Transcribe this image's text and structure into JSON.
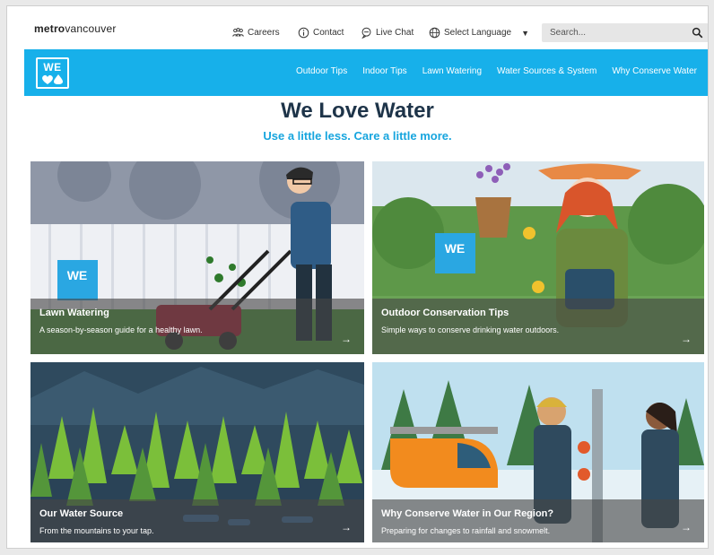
{
  "header": {
    "logo_bold": "metro",
    "logo_rest": "vancouver",
    "links": {
      "careers": "Careers",
      "contact": "Contact",
      "live_chat": "Live Chat",
      "language": "Select Language"
    },
    "search_placeholder": "Search..."
  },
  "nav": {
    "brand_text": "WE",
    "items": [
      "Outdoor Tips",
      "Indoor Tips",
      "Lawn Watering",
      "Water Sources & System",
      "Why Conserve Water"
    ]
  },
  "hero": {
    "title": "We Love Water",
    "subtitle": "Use a little less. Care a little more."
  },
  "cards": [
    {
      "title": "Lawn Watering",
      "desc": "A season-by-season guide for a healthy lawn.",
      "arrow": "→"
    },
    {
      "title": "Outdoor Conservation Tips",
      "desc": "Simple ways to conserve drinking water outdoors.",
      "arrow": "→"
    },
    {
      "title": "Our Water Source",
      "desc": "From the mountains to your tap.",
      "arrow": "→"
    },
    {
      "title": "Why Conserve Water in Our Region?",
      "desc": "Preparing for changes to rainfall and snowmelt.",
      "arrow": "→"
    }
  ],
  "colors": {
    "nav_blue": "#17b0ea",
    "title_navy": "#1e3449",
    "subtitle_blue": "#17a5de"
  }
}
